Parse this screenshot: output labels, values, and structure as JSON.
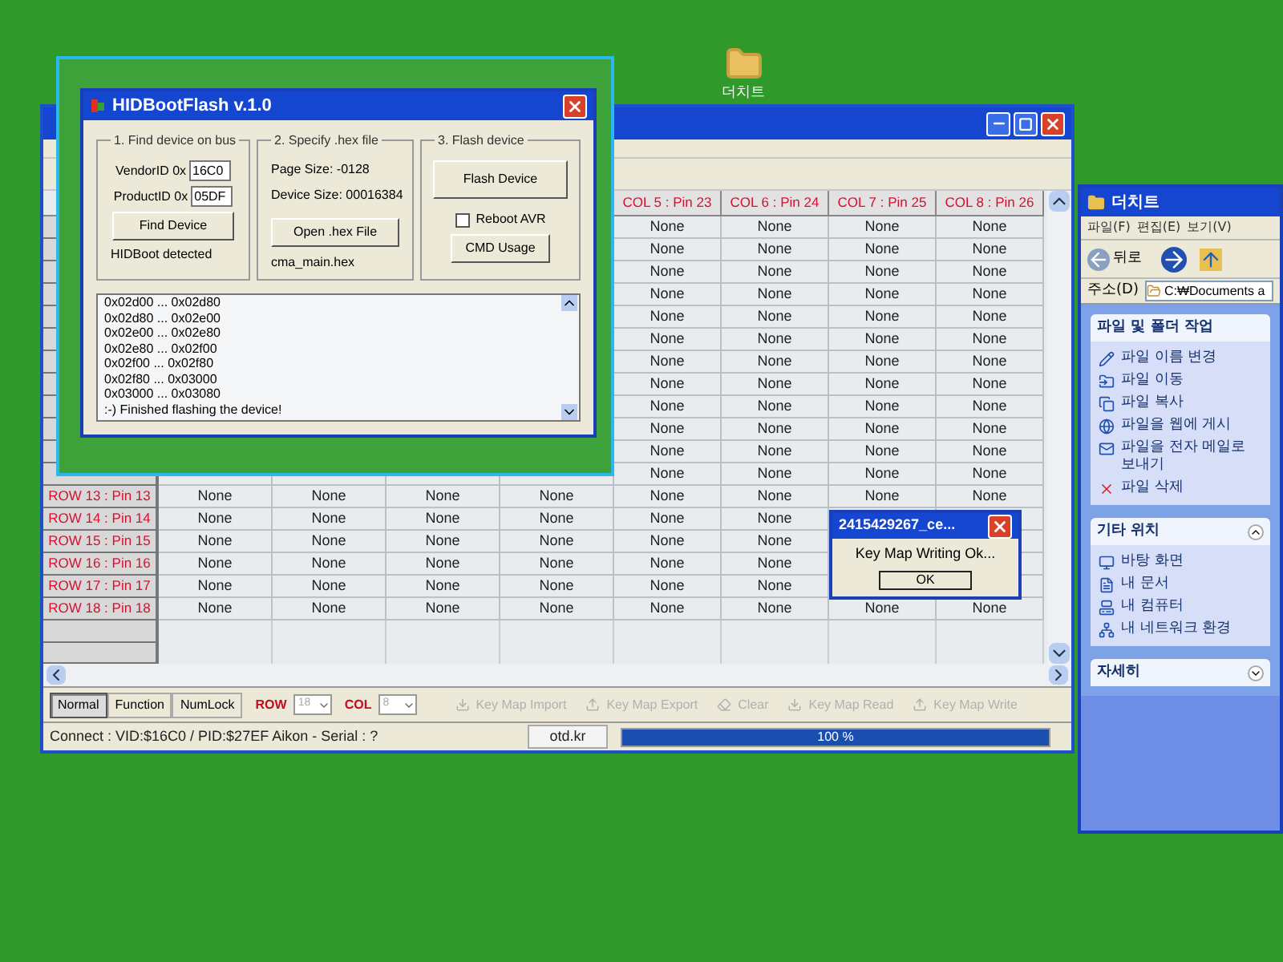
{
  "desktop_icon": {
    "label": "더치트"
  },
  "keymap_window": {
    "columns": [
      null,
      null,
      null,
      null,
      "COL 5 : Pin 23",
      "COL 6 : Pin 24",
      "COL 7 : Pin 25",
      "COL 8 : Pin 26"
    ],
    "rows": [
      {
        "label": null,
        "cells": [
          null,
          null,
          null,
          null,
          "None",
          "None",
          "None",
          "None"
        ]
      },
      {
        "label": null,
        "cells": [
          null,
          null,
          null,
          null,
          "None",
          "None",
          "None",
          "None"
        ]
      },
      {
        "label": null,
        "cells": [
          null,
          null,
          null,
          null,
          "None",
          "None",
          "None",
          "None"
        ]
      },
      {
        "label": null,
        "cells": [
          null,
          null,
          null,
          null,
          "None",
          "None",
          "None",
          "None"
        ]
      },
      {
        "label": null,
        "cells": [
          null,
          null,
          null,
          null,
          "None",
          "None",
          "None",
          "None"
        ]
      },
      {
        "label": null,
        "cells": [
          null,
          null,
          null,
          null,
          "None",
          "None",
          "None",
          "None"
        ]
      },
      {
        "label": null,
        "cells": [
          null,
          null,
          null,
          null,
          "None",
          "None",
          "None",
          "None"
        ]
      },
      {
        "label": null,
        "cells": [
          null,
          null,
          null,
          null,
          "None",
          "None",
          "None",
          "None"
        ]
      },
      {
        "label": null,
        "cells": [
          null,
          null,
          null,
          null,
          "None",
          "None",
          "None",
          "None"
        ]
      },
      {
        "label": null,
        "cells": [
          null,
          null,
          null,
          null,
          "None",
          "None",
          "None",
          "None"
        ]
      },
      {
        "label": null,
        "cells": [
          null,
          null,
          null,
          null,
          "None",
          "None",
          "None",
          "None"
        ]
      },
      {
        "label": null,
        "cells": [
          null,
          null,
          null,
          null,
          "None",
          "None",
          "None",
          "None"
        ]
      },
      {
        "label": "ROW 13 : Pin 13",
        "cells": [
          "None",
          "None",
          "None",
          "None",
          "None",
          "None",
          "None",
          "None"
        ]
      },
      {
        "label": "ROW 14 : Pin 14",
        "cells": [
          "None",
          "None",
          "None",
          "None",
          "None",
          "None",
          null,
          null
        ]
      },
      {
        "label": "ROW 15 : Pin 15",
        "cells": [
          "None",
          "None",
          "None",
          "None",
          "None",
          "None",
          null,
          null
        ]
      },
      {
        "label": "ROW 16 : Pin 16",
        "cells": [
          "None",
          "None",
          "None",
          "None",
          "None",
          "None",
          null,
          null
        ]
      },
      {
        "label": "ROW 17 : Pin 17",
        "cells": [
          "None",
          "None",
          "None",
          "None",
          "None",
          "None",
          null,
          null
        ]
      },
      {
        "label": "ROW 18 : Pin 18",
        "cells": [
          "None",
          "None",
          "None",
          "None",
          "None",
          "None",
          "None",
          "None"
        ]
      }
    ],
    "modes": [
      {
        "label": "Normal",
        "selected": true
      },
      {
        "label": "Function",
        "selected": false
      },
      {
        "label": "NumLock",
        "selected": false
      }
    ],
    "row_select": {
      "label": "ROW",
      "value": "18"
    },
    "col_select": {
      "label": "COL",
      "value": "8"
    },
    "actions": [
      {
        "label": "Key Map Import",
        "disabled": true
      },
      {
        "label": "Key Map Export",
        "disabled": true
      },
      {
        "label": "Clear",
        "disabled": true
      },
      {
        "label": "Key Map Read",
        "disabled": true
      },
      {
        "label": "Key Map Write",
        "disabled": true
      }
    ],
    "status_bar": {
      "connection": "Connect : VID:$16C0 / PID:$27EF Aikon - Serial : ?",
      "site": "otd.kr",
      "progress": {
        "level": 1,
        "reading": "100 %"
      }
    }
  },
  "hidbootflash": {
    "title": "HIDBootFlash v.1.0",
    "find": {
      "heading": "1. Find device on bus",
      "vendor_label": "VendorID 0x",
      "vendor_value": "16C0",
      "product_label": "ProductID 0x",
      "product_value": "05DF",
      "button": "Find Device",
      "status": "HIDBoot detected"
    },
    "hex": {
      "heading": "2. Specify .hex file",
      "page_size": "Page Size: -0128",
      "device_size": "Device Size: 00016384",
      "button": "Open .hex File",
      "file": "cma_main.hex"
    },
    "flash": {
      "heading": "3. Flash device",
      "button": "Flash Device",
      "reboot": {
        "label": "Reboot AVR",
        "checked": false
      },
      "cmd_button": "CMD Usage"
    },
    "log": [
      "0x02d00 ... 0x02d80",
      "0x02d80 ... 0x02e00",
      "0x02e00 ... 0x02e80",
      "0x02e80 ... 0x02f00",
      "0x02f00 ... 0x02f80",
      "0x02f80 ... 0x03000",
      "0x03000 ... 0x03080",
      ":-) Finished flashing the device!"
    ]
  },
  "dialog": {
    "title": "2415429267_ce...",
    "message": "Key Map Writing Ok...",
    "button": "OK"
  },
  "explorer": {
    "title": "더치트",
    "menu": [
      "파일(F)",
      "편집(E)",
      "보기(V)"
    ],
    "back": "뒤로",
    "address_label": "주소(D)",
    "address": "C:₩Documents a",
    "panels": [
      {
        "title": "파일 및 폴더 작업",
        "kind": "plain",
        "items": [
          {
            "label": "파일 이름 변경",
            "kind": "rename"
          },
          {
            "label": "파일 이동",
            "kind": "move"
          },
          {
            "label": "파일 복사",
            "kind": "copy"
          },
          {
            "label": "파일을 웹에 게시",
            "kind": "web"
          },
          {
            "label": "파일을 전자 메일로 보내기",
            "kind": "mail"
          },
          {
            "label": "파일 삭제",
            "kind": "delete"
          }
        ]
      },
      {
        "title": "기타 위치",
        "kind": "expanded",
        "items": [
          {
            "label": "바탕 화면",
            "kind": "desktop"
          },
          {
            "label": "내 문서",
            "kind": "documents"
          },
          {
            "label": "내 컴퓨터",
            "kind": "computer"
          },
          {
            "label": "내 네트워크 환경",
            "kind": "network"
          }
        ]
      },
      {
        "title": "자세히",
        "kind": "collapsed"
      }
    ]
  }
}
